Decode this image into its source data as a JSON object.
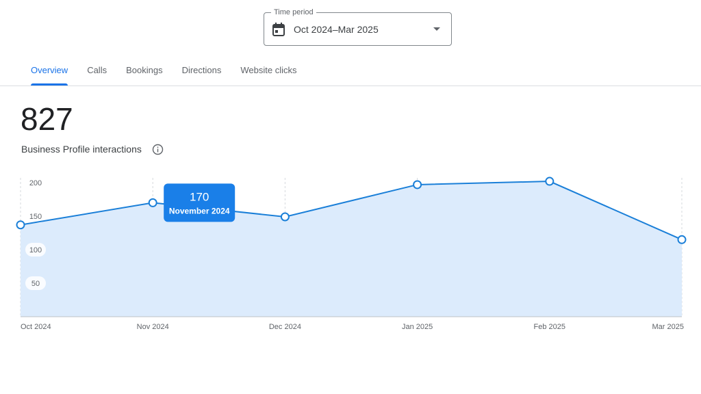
{
  "time_period": {
    "legend": "Time period",
    "value": "Oct 2024–Mar 2025",
    "icon": "calendar-icon"
  },
  "tabs": [
    {
      "label": "Overview",
      "active": true
    },
    {
      "label": "Calls",
      "active": false
    },
    {
      "label": "Bookings",
      "active": false
    },
    {
      "label": "Directions",
      "active": false
    },
    {
      "label": "Website clicks",
      "active": false
    }
  ],
  "summary": {
    "total": "827",
    "label": "Business Profile interactions",
    "info_icon": "info-icon"
  },
  "colors": {
    "accent": "#1a73e8",
    "line": "#1a7fd8",
    "area_fill": "#dcebfc",
    "tooltip_bg": "#1a7fe8"
  },
  "chart_data": {
    "type": "area",
    "x": [
      "Oct 2024",
      "Nov 2024",
      "Dec 2024",
      "Jan 2025",
      "Feb 2025",
      "Mar 2025"
    ],
    "series": [
      {
        "values": [
          137,
          170,
          149,
          197,
          202,
          115
        ]
      }
    ],
    "y_ticks": [
      200,
      150,
      100,
      50
    ],
    "ylim": [
      0,
      200
    ],
    "grid": "vertical dashed",
    "tooltip": {
      "value": "170",
      "label": "November 2024",
      "index": 1
    }
  }
}
